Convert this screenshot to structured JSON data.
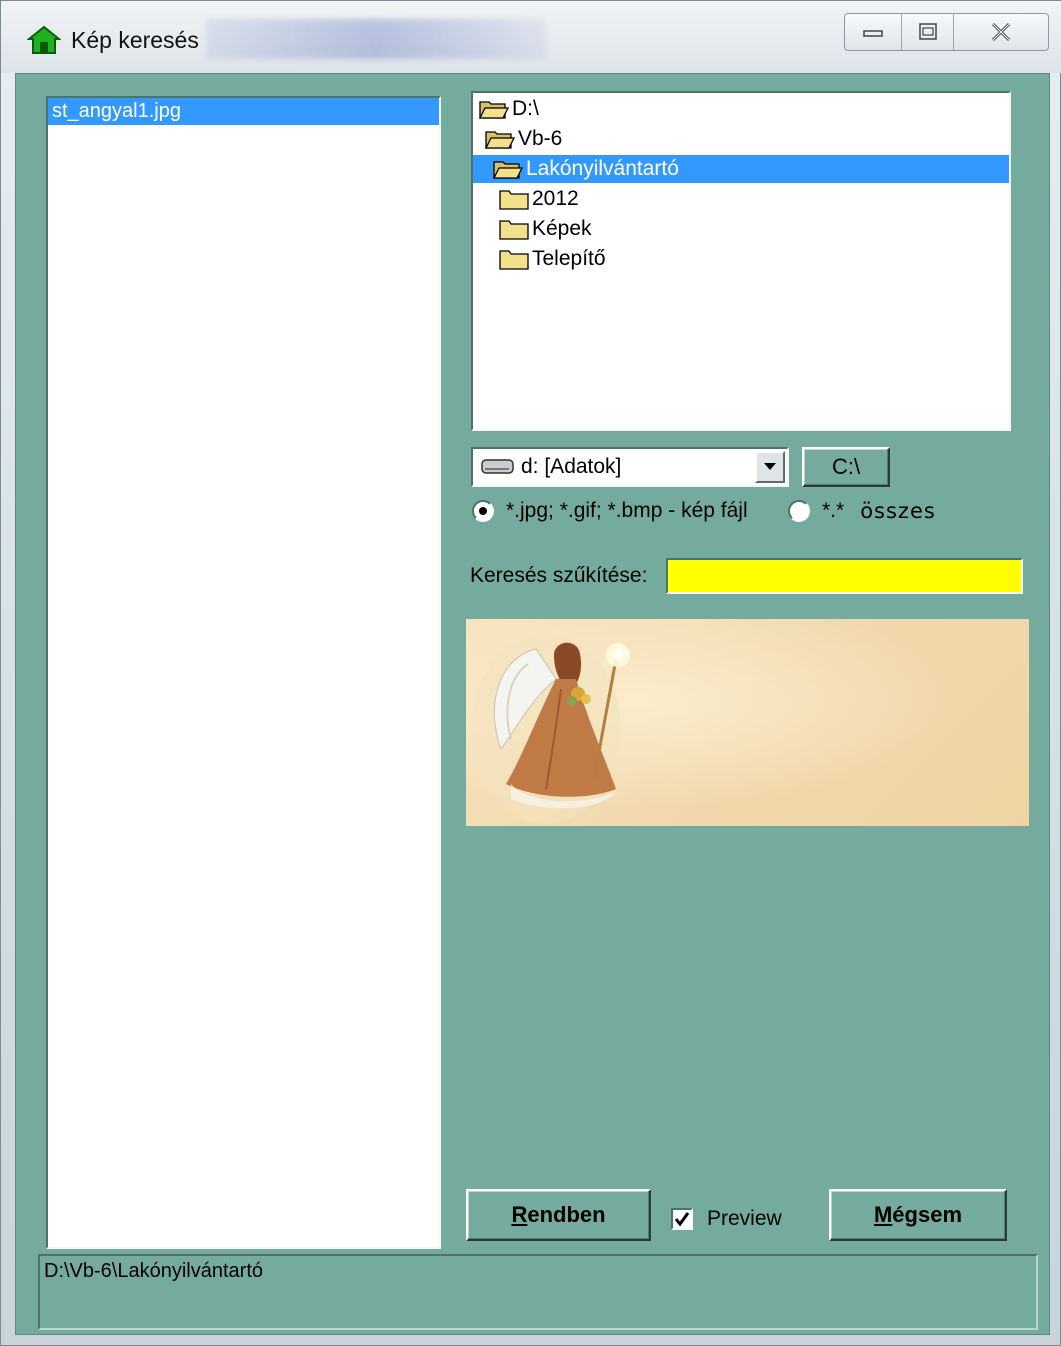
{
  "window": {
    "title": "Kép keresés",
    "buttons": {
      "minimize_icon": "minimize-icon",
      "maximize_icon": "maximize-icon",
      "close_icon": "close-icon"
    }
  },
  "file_list": {
    "items": [
      "st_angyal1.jpg"
    ],
    "selected_index": 0
  },
  "dir_tree": {
    "items": [
      {
        "label": "D:\\",
        "icon": "open-folder-icon"
      },
      {
        "label": "Vb-6",
        "icon": "open-folder-icon"
      },
      {
        "label": "Lakónyilvántartó",
        "icon": "open-folder-icon",
        "selected": true
      },
      {
        "label": "2012",
        "icon": "folder-icon"
      },
      {
        "label": "Képek",
        "icon": "folder-icon"
      },
      {
        "label": "Telepítő",
        "icon": "folder-icon"
      }
    ]
  },
  "drive": {
    "selected": "d: [Adatok]",
    "icon": "drive-icon"
  },
  "root_button": {
    "label": "C:\\"
  },
  "filters": {
    "image_option": "*.jpg; *.gif; *.bmp -  kép fájl",
    "image_selected": true,
    "all_option_pattern": "*.*",
    "all_option_label": "összes"
  },
  "search": {
    "label": "Keresés szűkítése:",
    "value": "",
    "background": "#ffff00"
  },
  "preview_image": {
    "description_icon": "angel-picture"
  },
  "actions": {
    "ok_label_u": "R",
    "ok_label_rest": "endben",
    "preview_label": "Preview",
    "preview_checked": true,
    "cancel_label_u": "M",
    "cancel_label_rest": "égsem"
  },
  "status": {
    "path": "D:\\Vb-6\\Lakónyilvántartó"
  },
  "colors": {
    "dialog_bg": "#75ab9f",
    "selection": "#3399ff"
  }
}
